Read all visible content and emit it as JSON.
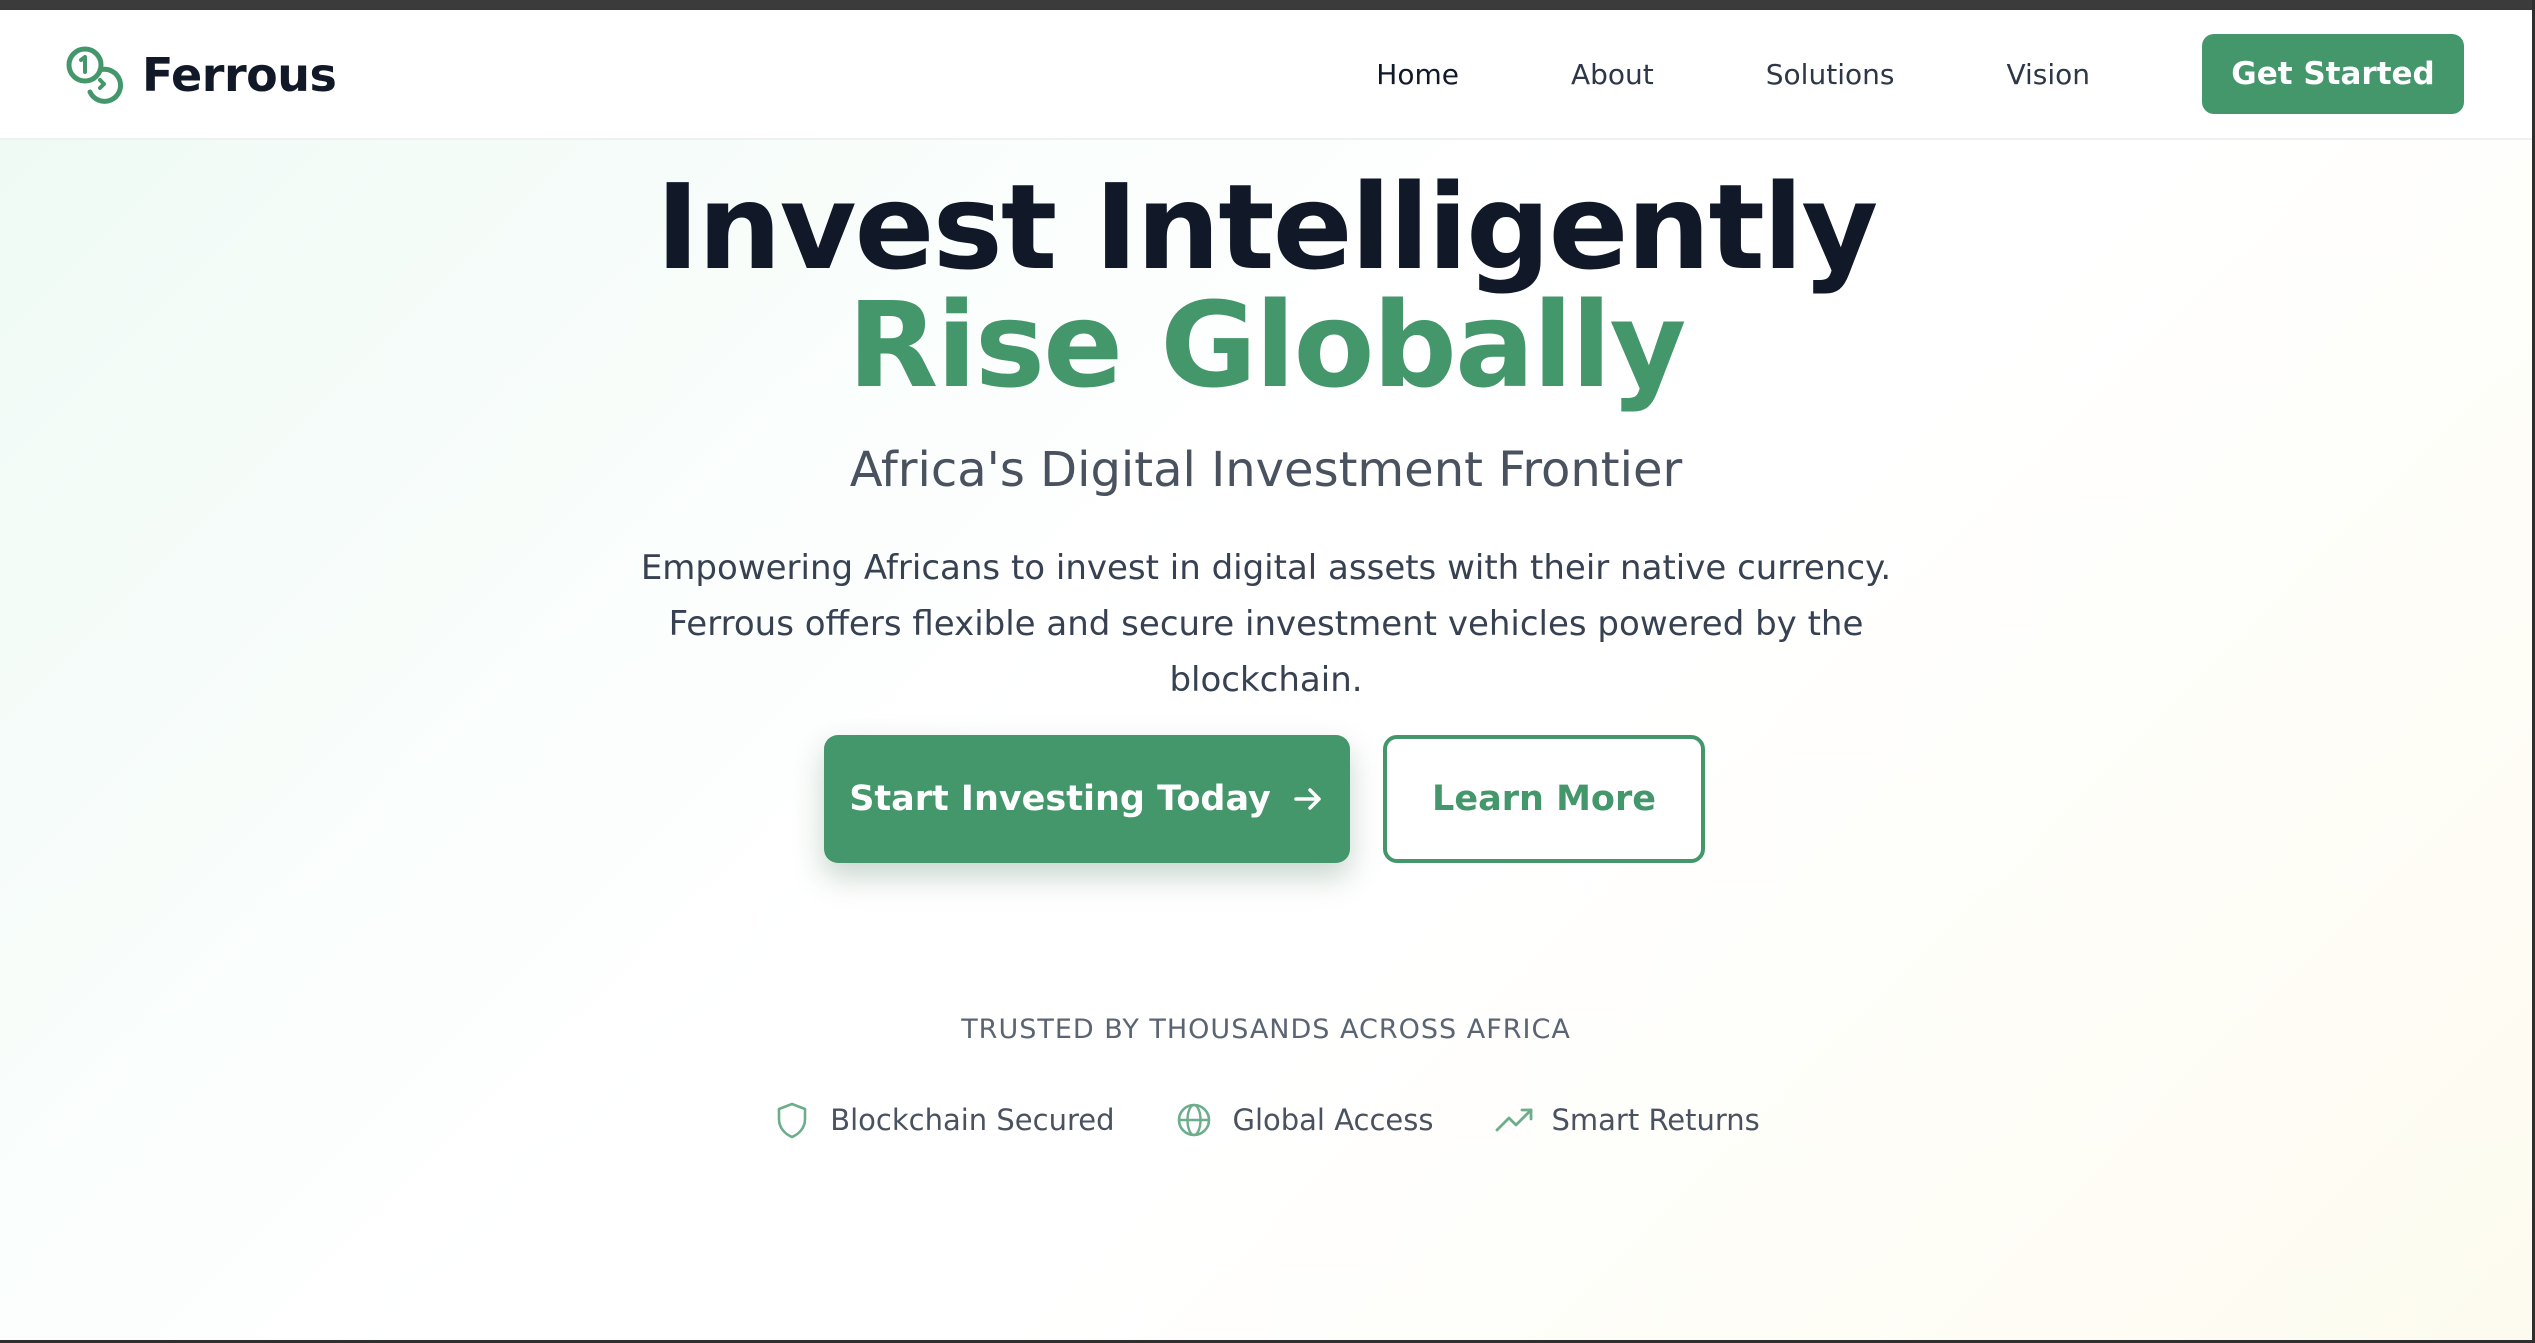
{
  "brand": {
    "name": "Ferrous",
    "icon": "coins-icon",
    "color": "#44966b"
  },
  "nav": {
    "items": [
      {
        "label": "Home",
        "active": true
      },
      {
        "label": "About",
        "active": false
      },
      {
        "label": "Solutions",
        "active": false
      },
      {
        "label": "Vision",
        "active": false
      }
    ],
    "cta_label": "Get Started"
  },
  "hero": {
    "headline_line1": "Invest Intelligently",
    "headline_line2": "Rise Globally",
    "subtitle": "Africa's Digital Investment Frontier",
    "description": "Empowering Africans to invest in digital assets with their native currency. Ferrous offers flexible and secure investment vehicles powered by the blockchain.",
    "primary_button": {
      "label": "Start Investing Today",
      "icon": "arrow-right-icon"
    },
    "secondary_button": {
      "label": "Learn More"
    }
  },
  "trust": {
    "heading": "TRUSTED BY THOUSANDS ACROSS AFRICA",
    "features": [
      {
        "label": "Blockchain Secured",
        "icon": "shield-icon"
      },
      {
        "label": "Global Access",
        "icon": "globe-icon"
      },
      {
        "label": "Smart Returns",
        "icon": "trending-up-icon"
      }
    ]
  },
  "colors": {
    "accent": "#44966b",
    "headline": "#111827",
    "body_text": "#374151"
  }
}
